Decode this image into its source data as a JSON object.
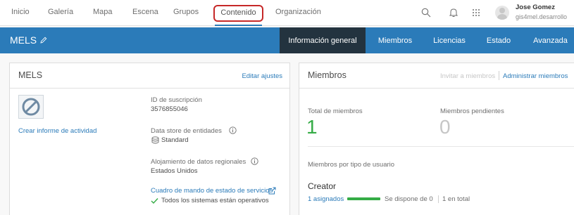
{
  "topnav": {
    "items": [
      "Inicio",
      "Galería",
      "Mapa",
      "Escena",
      "Grupos",
      "Contenido",
      "Organización"
    ],
    "user_name": "Jose Gomez",
    "user_handle": "gis4mel.desarrollo"
  },
  "org_bar": {
    "title": "MELS",
    "tabs": [
      "Información general",
      "Miembros",
      "Licencias",
      "Estado",
      "Avanzada"
    ],
    "active_tab": "Información general"
  },
  "left_panel": {
    "title": "MELS",
    "edit_link": "Editar ajustes",
    "activity_link": "Crear informe de actividad",
    "subscription_label": "ID de suscripción",
    "subscription_id": "3576855046",
    "datastore_label": "Data store de entidades",
    "datastore_value": "Standard",
    "hosting_label": "Alojamiento de datos regionales",
    "hosting_value": "Estados Unidos",
    "dashboard_link": "Cuadro de mando de estado de servicios",
    "status_text": "Todos los sistemas están operativos"
  },
  "right_panel": {
    "title": "Miembros",
    "invite_link": "Invitar a miembros",
    "manage_link": "Administrar miembros",
    "total_label": "Total de miembros",
    "total_value": "1",
    "pending_label": "Miembros pendientes",
    "pending_value": "0",
    "by_type_label": "Miembros por tipo de usuario",
    "type_name": "Creator",
    "assigned": "1 asignados",
    "available": "Se dispone de 0",
    "total": "1 en total",
    "assigned_fraction": 1.0
  },
  "colors": {
    "accent": "#2b7bb9",
    "dark_tab": "#23333f",
    "green": "#35ac46",
    "highlight": "#c62828"
  }
}
